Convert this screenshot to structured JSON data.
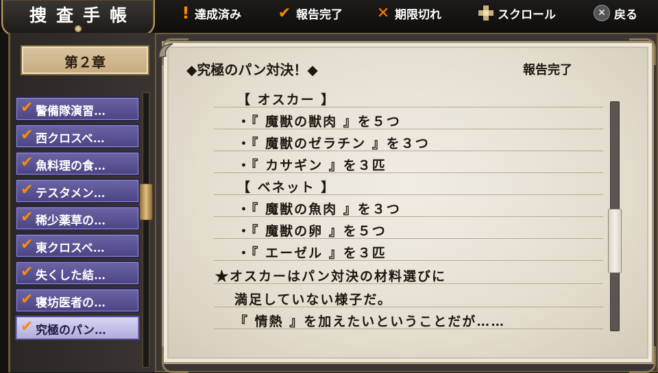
{
  "header": {
    "title": "捜査手帳",
    "legend": [
      {
        "icon": "exclamation-icon",
        "label": "達成済み"
      },
      {
        "icon": "check-icon",
        "label": "報告完了"
      },
      {
        "icon": "x-icon",
        "label": "期限切れ"
      },
      {
        "icon": "dpad-icon",
        "label": "スクロール"
      },
      {
        "icon": "circle-x-button-icon",
        "label": "戻る"
      }
    ]
  },
  "sidebar": {
    "chapter": "第２章",
    "quests": [
      {
        "label": "警備隊演習…"
      },
      {
        "label": "西クロスベ…"
      },
      {
        "label": "魚料理の食…"
      },
      {
        "label": "テスタメン…"
      },
      {
        "label": "稀少薬草の…"
      },
      {
        "label": "東クロスベ…"
      },
      {
        "label": "失くした結…"
      },
      {
        "label": "寝坊医者の…"
      },
      {
        "label": "究極のパン…"
      }
    ],
    "selected_index": 8
  },
  "detail": {
    "title": "◆究極のパン対決！◆",
    "status": "報告完了",
    "lines": [
      "【 オスカー 】",
      "・『 魔獣の獣肉 』を５つ",
      "・『 魔獣のゼラチン 』を３つ",
      "・『 カサギン 』を３匹",
      "【 ベネット 】",
      "・『 魔獣の魚肉 』を３つ",
      "・『 魔獣の卵 』を５つ",
      "・『 エーゼル 』を３匹",
      "★オスカーはパン対決の材料選びに",
      "満足していない様子だ。",
      "『 情熱 』を加えたいということだが……"
    ]
  },
  "colors": {
    "accent_orange": "#ff8a00",
    "quest_button": "#5a549a",
    "parchment": "#ece7dc"
  }
}
